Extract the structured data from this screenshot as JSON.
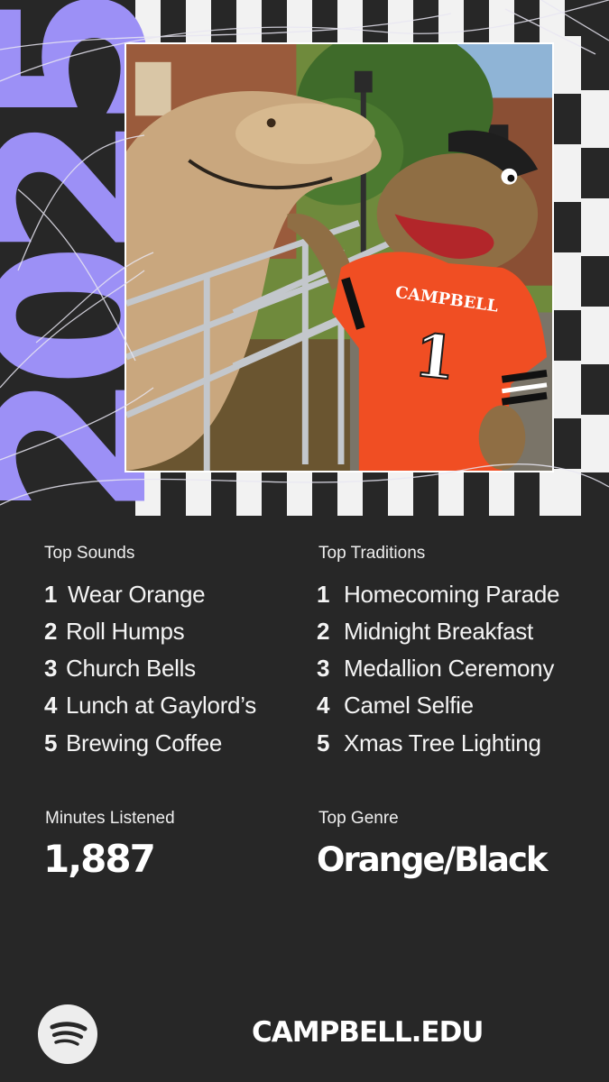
{
  "graphic": {
    "year": "2025",
    "photo_caption": "",
    "jersey_text": "CAMPBELL",
    "jersey_number": "1"
  },
  "colors": {
    "background": "#272727",
    "accent_purple": "#9c90f6",
    "stripe_light": "#f2f2f2",
    "jersey_orange": "#f04e23"
  },
  "top_sounds": {
    "heading": "Top Sounds",
    "items": [
      {
        "num": "1",
        "label": "Wear Orange"
      },
      {
        "num": "2",
        "label": "Roll Humps"
      },
      {
        "num": "3",
        "label": "Church Bells"
      },
      {
        "num": "4",
        "label": "Lunch at Gaylord’s"
      },
      {
        "num": "5",
        "label": "Brewing Coffee"
      }
    ]
  },
  "top_traditions": {
    "heading": "Top Traditions",
    "items": [
      {
        "num": "1",
        "label": "Homecoming Parade"
      },
      {
        "num": "2",
        "label": "Midnight Breakfast"
      },
      {
        "num": "3",
        "label": "Medallion Ceremony"
      },
      {
        "num": "4",
        "label": "Camel Selfie"
      },
      {
        "num": "5",
        "label": "Xmas Tree Lighting"
      }
    ]
  },
  "minutes": {
    "label": "Minutes Listened",
    "value": "1,887"
  },
  "genre": {
    "label": "Top Genre",
    "value": "Orange/Black"
  },
  "footer": {
    "logo_icon": "spotify-icon",
    "url": "CAMPBELL.EDU"
  }
}
